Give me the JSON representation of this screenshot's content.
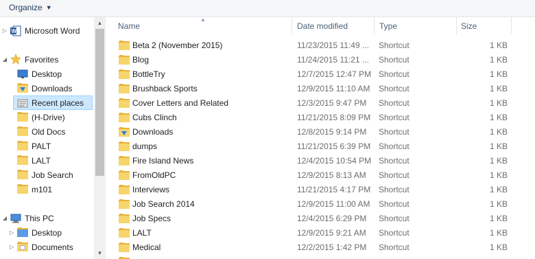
{
  "toolbar": {
    "organize_label": "Organize"
  },
  "nav": {
    "items": [
      {
        "label": "Microsoft Word",
        "icon": "word-icon",
        "arrow": "▷"
      },
      {
        "label": "Favorites",
        "icon": "star-icon",
        "arrow": "◢"
      },
      {
        "label": "Desktop",
        "icon": "desktop-icon",
        "arrow": ""
      },
      {
        "label": "Downloads",
        "icon": "downloads-folder-icon",
        "arrow": ""
      },
      {
        "label": "Recent places",
        "icon": "recent-places-icon",
        "arrow": ""
      },
      {
        "label": "(H-Drive)",
        "icon": "folder-icon",
        "arrow": ""
      },
      {
        "label": "Old Docs",
        "icon": "folder-icon",
        "arrow": ""
      },
      {
        "label": "PALT",
        "icon": "folder-icon",
        "arrow": ""
      },
      {
        "label": "LALT",
        "icon": "folder-icon",
        "arrow": ""
      },
      {
        "label": "Job Search",
        "icon": "folder-icon",
        "arrow": ""
      },
      {
        "label": "m101",
        "icon": "folder-icon",
        "arrow": ""
      },
      {
        "label": "This PC",
        "icon": "computer-icon",
        "arrow": "◢"
      },
      {
        "label": "Desktop",
        "icon": "desktop-folder-icon",
        "arrow": "▷"
      },
      {
        "label": "Documents",
        "icon": "documents-folder-icon",
        "arrow": "▷"
      }
    ]
  },
  "columns": {
    "name": "Name",
    "date": "Date modified",
    "type": "Type",
    "size": "Size"
  },
  "files": [
    {
      "name": "Beta 2 (November 2015)",
      "date": "11/23/2015 11:49 ...",
      "type": "Shortcut",
      "size": "1 KB",
      "icon": "folder-shortcut-icon"
    },
    {
      "name": "Blog",
      "date": "11/24/2015 11:21 ...",
      "type": "Shortcut",
      "size": "1 KB",
      "icon": "folder-shortcut-icon"
    },
    {
      "name": "BottleTry",
      "date": "12/7/2015 12:47 PM",
      "type": "Shortcut",
      "size": "1 KB",
      "icon": "folder-shortcut-icon"
    },
    {
      "name": "Brushback Sports",
      "date": "12/9/2015 11:10 AM",
      "type": "Shortcut",
      "size": "1 KB",
      "icon": "folder-shortcut-icon"
    },
    {
      "name": "Cover Letters and Related",
      "date": "12/3/2015 9:47 PM",
      "type": "Shortcut",
      "size": "1 KB",
      "icon": "folder-shortcut-icon"
    },
    {
      "name": "Cubs Clinch",
      "date": "11/21/2015 8:09 PM",
      "type": "Shortcut",
      "size": "1 KB",
      "icon": "folder-shortcut-icon"
    },
    {
      "name": "Downloads",
      "date": "12/8/2015 9:14 PM",
      "type": "Shortcut",
      "size": "1 KB",
      "icon": "downloads-shortcut-icon"
    },
    {
      "name": "dumps",
      "date": "11/21/2015 6:39 PM",
      "type": "Shortcut",
      "size": "1 KB",
      "icon": "folder-shortcut-icon"
    },
    {
      "name": "Fire Island News",
      "date": "12/4/2015 10:54 PM",
      "type": "Shortcut",
      "size": "1 KB",
      "icon": "folder-shortcut-icon"
    },
    {
      "name": "FromOldPC",
      "date": "12/9/2015 8:13 AM",
      "type": "Shortcut",
      "size": "1 KB",
      "icon": "folder-shortcut-icon"
    },
    {
      "name": "Interviews",
      "date": "11/21/2015 4:17 PM",
      "type": "Shortcut",
      "size": "1 KB",
      "icon": "folder-shortcut-icon"
    },
    {
      "name": "Job Search 2014",
      "date": "12/9/2015 11:00 AM",
      "type": "Shortcut",
      "size": "1 KB",
      "icon": "folder-shortcut-icon"
    },
    {
      "name": "Job Specs",
      "date": "12/4/2015 6:29 PM",
      "type": "Shortcut",
      "size": "1 KB",
      "icon": "folder-shortcut-icon"
    },
    {
      "name": "LALT",
      "date": "12/9/2015 9:21 AM",
      "type": "Shortcut",
      "size": "1 KB",
      "icon": "folder-shortcut-icon"
    },
    {
      "name": "Medical",
      "date": "12/2/2015 1:42 PM",
      "type": "Shortcut",
      "size": "1 KB",
      "icon": "folder-shortcut-icon"
    }
  ]
}
